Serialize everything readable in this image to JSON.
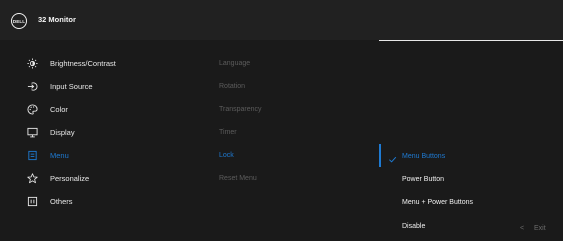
{
  "header": {
    "logo_text": "DELL",
    "title": "32 Monitor"
  },
  "menu": [
    {
      "label": "Brightness/Contrast",
      "icon": "sun-icon"
    },
    {
      "label": "Input Source",
      "icon": "input-icon"
    },
    {
      "label": "Color",
      "icon": "palette-icon"
    },
    {
      "label": "Display",
      "icon": "monitor-icon"
    },
    {
      "label": "Menu",
      "icon": "menu-icon"
    },
    {
      "label": "Personalize",
      "icon": "star-icon"
    },
    {
      "label": "Others",
      "icon": "others-icon"
    }
  ],
  "submenu": [
    {
      "label": "Language"
    },
    {
      "label": "Rotation"
    },
    {
      "label": "Transparency"
    },
    {
      "label": "Timer"
    },
    {
      "label": "Lock"
    },
    {
      "label": "Reset Menu"
    }
  ],
  "options": [
    {
      "label": "Menu Buttons"
    },
    {
      "label": "Power Button"
    },
    {
      "label": "Menu + Power Buttons"
    },
    {
      "label": "Disable"
    }
  ],
  "footer": {
    "exit_label": "Exit",
    "exit_arrow": "<"
  },
  "colors": {
    "accent": "#1e7ad2",
    "background": "#1a1a1a",
    "header": "#212121"
  }
}
